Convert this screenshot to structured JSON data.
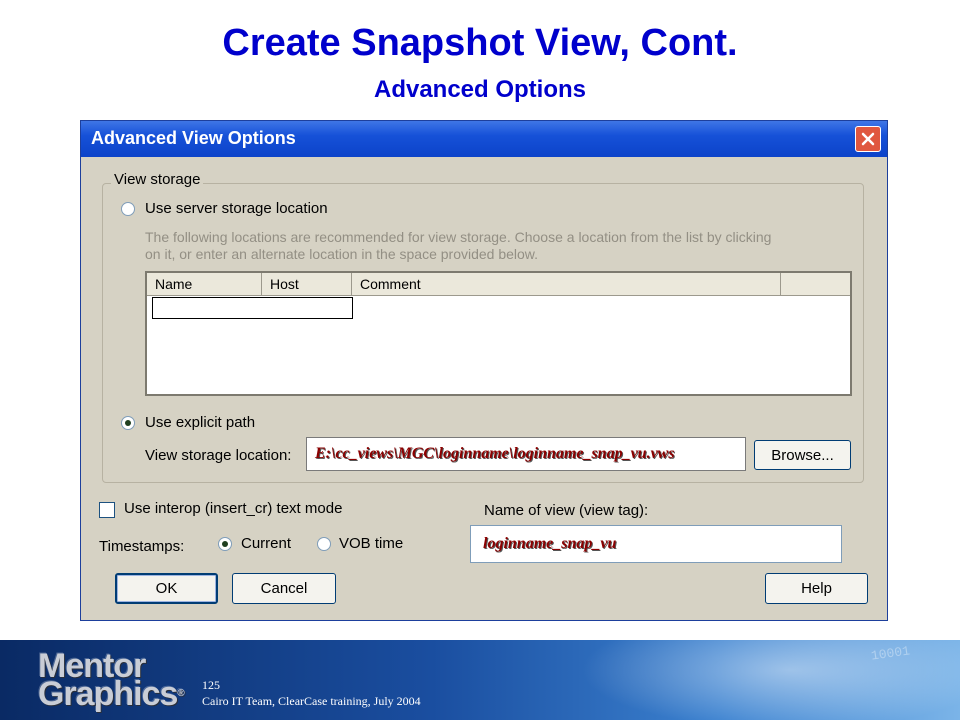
{
  "slide": {
    "title": "Create Snapshot View, Cont.",
    "subtitle": "Advanced Options"
  },
  "dialog": {
    "title": "Advanced View Options",
    "close_icon": "close-icon",
    "view_storage": {
      "legend": "View storage",
      "server_option_label": "Use server storage location",
      "server_option_selected": false,
      "hint_line1": "The following locations are recommended for view storage. Choose a location from the list by clicking",
      "hint_line2": "on it, or enter an alternate location in the space provided below.",
      "columns": [
        "Name",
        "Host",
        "Comment"
      ],
      "explicit_option_label": "Use explicit path",
      "explicit_option_selected": true,
      "location_label": "View storage location:",
      "location_value": "E:\\cc_views\\MGC\\loginname\\loginname_snap_vu.vws",
      "browse_label": "Browse..."
    },
    "interop_label": "Use interop (insert_cr) text mode",
    "interop_checked": false,
    "timestamps_label": "Timestamps:",
    "timestamp_options": [
      "Current",
      "VOB time"
    ],
    "timestamp_selected": "Current",
    "view_tag_label": "Name of view (view tag):",
    "view_tag_value": "loginname_snap_vu",
    "ok_label": "OK",
    "cancel_label": "Cancel",
    "help_label": "Help"
  },
  "footer": {
    "logo_line1": "Mentor",
    "logo_line2": "Graphics",
    "logo_mark": "®",
    "page_number": "125",
    "credit": "Cairo IT Team, ClearCase training, July 2004"
  },
  "colors": {
    "title": "#0000cc",
    "titlebar": "#1651d8",
    "dialog_face": "#d6d2c4",
    "path_text": "#8b0000"
  }
}
